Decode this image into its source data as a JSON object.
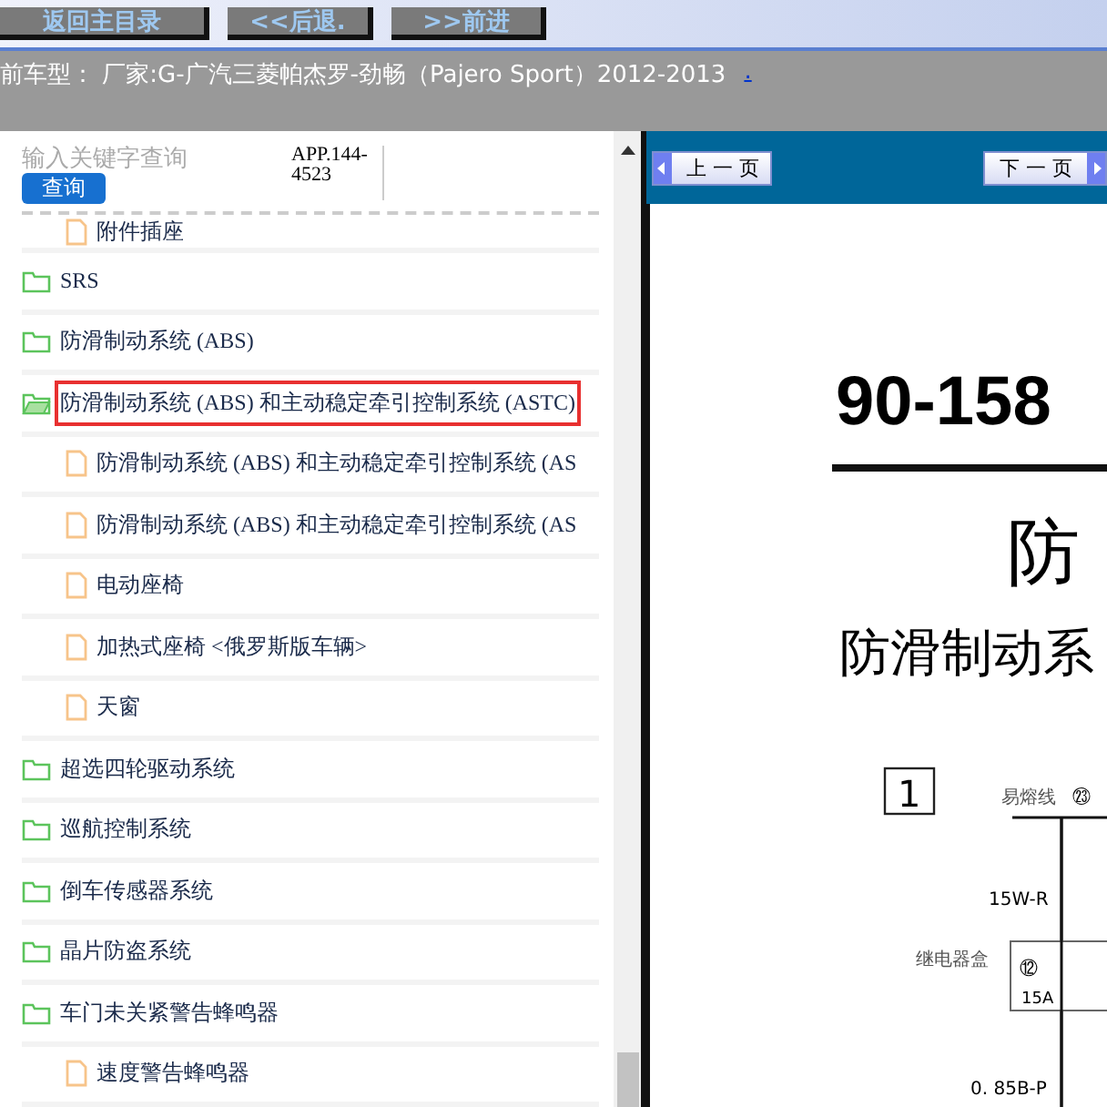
{
  "top_buttons": [
    "返回主目录",
    "<<后退.",
    ">>前进"
  ],
  "header": {
    "text": "前车型：  厂家:G-广汽三菱帕杰罗-劲畅（Pajero Sport）2012-2013",
    "link": "."
  },
  "search": {
    "placeholder": "输入关键字查询",
    "button": "查询",
    "code": "APP.144-4523"
  },
  "tree": [
    {
      "label": "附件插座",
      "kind": "file",
      "selected": false
    },
    {
      "label": "SRS",
      "kind": "folder",
      "expanded": false,
      "selected": false
    },
    {
      "label": "防滑制动系统 (ABS)",
      "kind": "folder",
      "expanded": false,
      "selected": false
    },
    {
      "label": "防滑制动系统 (ABS) 和主动稳定牵引控制系统 (ASTC)",
      "kind": "folder",
      "expanded": true,
      "selected": true,
      "children": [
        {
          "label": "防滑制动系统 (ABS) 和主动稳定牵引控制系统 (AS",
          "kind": "file",
          "selected": false
        },
        {
          "label": "防滑制动系统 (ABS) 和主动稳定牵引控制系统 (AS",
          "kind": "file",
          "selected": false
        },
        {
          "label": "电动座椅",
          "kind": "file",
          "selected": false
        },
        {
          "label": "加热式座椅 <俄罗斯版车辆>",
          "kind": "file",
          "selected": false
        },
        {
          "label": "天窗",
          "kind": "file",
          "selected": false
        }
      ]
    },
    {
      "label": "超选四轮驱动系统",
      "kind": "folder",
      "expanded": false,
      "selected": false
    },
    {
      "label": "巡航控制系统",
      "kind": "folder",
      "expanded": false,
      "selected": false
    },
    {
      "label": "倒车传感器系统",
      "kind": "folder",
      "expanded": false,
      "selected": false
    },
    {
      "label": "晶片防盗系统",
      "kind": "folder",
      "expanded": false,
      "selected": false
    },
    {
      "label": "车门未关紧警告蜂鸣器",
      "kind": "folder",
      "expanded": false,
      "selected": false,
      "children": [
        {
          "label": "速度警告蜂鸣器",
          "kind": "file",
          "selected": false
        }
      ]
    }
  ],
  "viewer": {
    "prev": "上 一 页",
    "next": "下 一 页",
    "page_number": "90-158",
    "title": "防",
    "subtitle": "防滑制动系",
    "diagram": {
      "section": "1",
      "fusible_link": "易熔线",
      "fusible_link_no": "㉓",
      "wire_1": "15W-R",
      "relay_box": "继电器盒",
      "fuse_no": "⑫",
      "fuse_rating": "15A",
      "wire_2": "0. 85B-P"
    }
  }
}
